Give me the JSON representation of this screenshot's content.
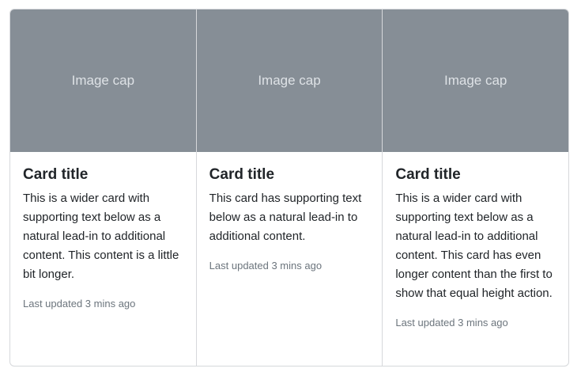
{
  "cards": [
    {
      "image_cap": "Image cap",
      "title": "Card title",
      "text": "This is a wider card with supporting text below as a natural lead-in to additional content. This content is a little bit longer.",
      "updated": "Last updated 3 mins ago"
    },
    {
      "image_cap": "Image cap",
      "title": "Card title",
      "text": "This card has supporting text below as a natural lead-in to additional content.",
      "updated": "Last updated 3 mins ago"
    },
    {
      "image_cap": "Image cap",
      "title": "Card title",
      "text": "This is a wider card with supporting text below as a natural lead-in to additional content. This card has even longer content than the first to show that equal height action.",
      "updated": "Last updated 3 mins ago"
    }
  ],
  "colors": {
    "image_cap_bg": "#868e96",
    "image_cap_text": "#dee2e6",
    "border": "#d6d8db",
    "muted_text": "#6c757d"
  }
}
